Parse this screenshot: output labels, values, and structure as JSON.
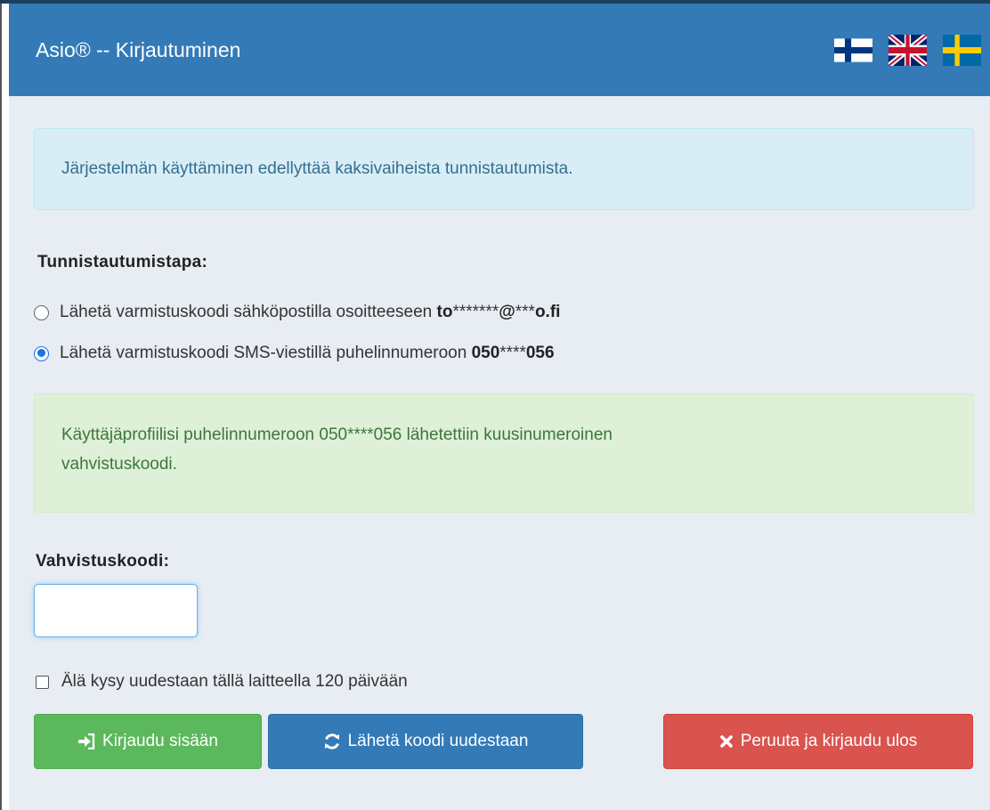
{
  "header": {
    "title": "Asio® -- Kirjautuminen",
    "languages": [
      {
        "name": "finnish-flag-icon",
        "colors": {
          "bg": "#ffffff",
          "cross": "#003580"
        }
      },
      {
        "name": "uk-flag-icon",
        "colors": {
          "blue": "#012169",
          "red": "#C8102E"
        }
      },
      {
        "name": "swedish-flag-icon",
        "colors": {
          "bg": "#006AA7",
          "cross": "#FECC00"
        }
      }
    ]
  },
  "info_alert": {
    "text": "Järjestelmän käyttäminen edellyttää kaksivaiheista tunnistautumista."
  },
  "method": {
    "label": "Tunnistautumistapa:",
    "options": [
      {
        "text": "Lähetä varmistuskoodi sähköpostilla osoitteeseen ",
        "prefix_bold": "to",
        "masked_mid": "*******",
        "at_bold": "@",
        "masked_domain": "***",
        "suffix_bold": "o.fi",
        "checked": false
      },
      {
        "text": "Lähetä varmistuskoodi SMS-viestillä puhelinnumeroon ",
        "prefix_bold": "050",
        "masked_mid": "****",
        "suffix_bold": "056",
        "checked": true
      }
    ]
  },
  "success_alert": {
    "line1": "Käyttäjäprofiilisi puhelinnumeroon 050****056 lähetettiin kuusinumeroinen",
    "line2": "vahvistuskoodi."
  },
  "code": {
    "label": "Vahvistuskoodi:",
    "value": ""
  },
  "remember": {
    "label": "Älä kysy uudestaan tällä laitteella 120 päivään",
    "checked": false
  },
  "buttons": {
    "login": {
      "label": "Kirjaudu sisään",
      "icon": "sign-in-icon",
      "color": "#5cb85c"
    },
    "resend": {
      "label": "Lähetä koodi uudestaan",
      "icon": "refresh-icon",
      "color": "#337ab7"
    },
    "cancel": {
      "label": "Peruuta ja kirjaudu ulos",
      "icon": "close-icon",
      "color": "#d9534f"
    }
  }
}
